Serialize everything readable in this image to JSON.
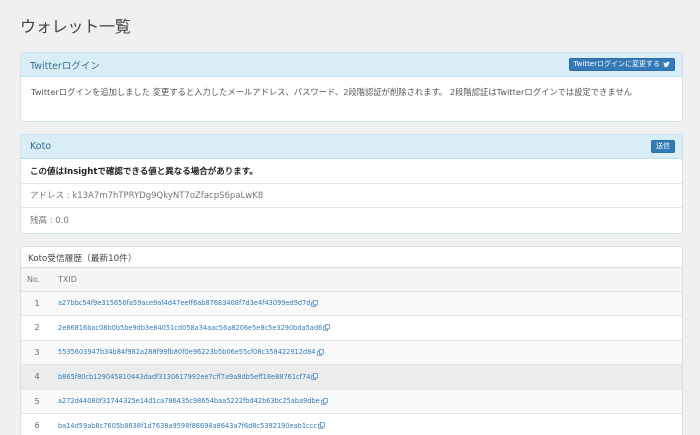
{
  "page": {
    "title": "ウォレット一覧"
  },
  "twitter_panel": {
    "heading": "Twitterログイン",
    "button_label": "Twitterログインに変更する",
    "button_icon": "twitter-bird-icon",
    "body": "Twitterログインを追加しました 変更すると入力したメールアドレス、パスワード、2段階認証が削除されます。 2段階認証はTwitterログインでは設定できません"
  },
  "koto_panel": {
    "heading": "Koto",
    "send_button": "送信",
    "warning": "この値はInsightで確認できる値と異なる場合があります。",
    "address": "アドレス : k13A7m7hTPRYDg9QkyNT7oZfacpS6paLwK8",
    "balance": "残高 : 0.0"
  },
  "history": {
    "heading": "Koto受信履歴（最新10件）",
    "columns": [
      "No.",
      "TXID"
    ],
    "rows": [
      {
        "no": "1",
        "txid": "a27bbc54f9e315650fa59ace9af4d47eeff6ab87683408f7d3e4f43099ed9d7d"
      },
      {
        "no": "2",
        "txid": "2e86816bac08b0b5be9db3e84051cd058a34aac56a8206e5e8c5e3290bda5ad6"
      },
      {
        "no": "3",
        "txid": "5535603947b34b84f982a288f99fb80f0e96223b5b06e55cf08c358422912d84"
      },
      {
        "no": "4",
        "txid": "b865f80cb129045810443dadf3130617992ee7cff7a9a8db5eff18e88761cf74"
      },
      {
        "no": "5",
        "txid": "a272d44080f31744325e14d1ca786435c98654baa5222fbd42b63bc25aba9dbe"
      },
      {
        "no": "6",
        "txid": "ba14d59ab8c7605b8638f1d7638a9598f86698a8643a7f6d8c5392190eab1ccc"
      }
    ]
  },
  "colors": {
    "panel_heading_bg": "#d9edf7",
    "panel_heading_text": "#31708f",
    "primary_button": "#337ab7",
    "link": "#337ab7"
  }
}
